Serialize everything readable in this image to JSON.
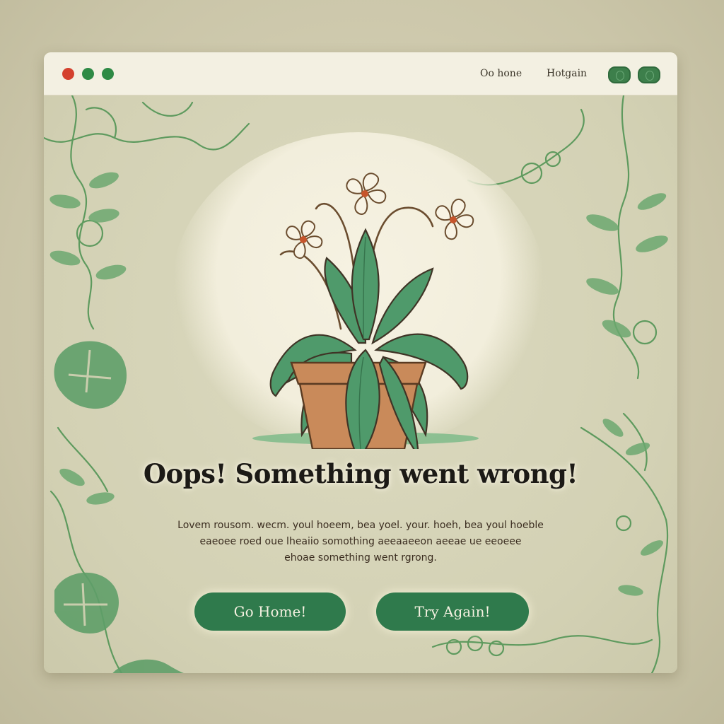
{
  "window": {
    "traffic_lights": [
      {
        "name": "close",
        "color": "#d4412e"
      },
      {
        "name": "minimize",
        "color": "#2e8a45"
      },
      {
        "name": "maximize",
        "color": "#2e8a45"
      }
    ],
    "nav": {
      "home_label": "Oo hone",
      "second_label": "Hotgain"
    },
    "toolbar_icons": [
      "toggle-icon",
      "toggle-icon"
    ]
  },
  "error": {
    "headline": "Oops! Something went wrong!",
    "body_lines": [
      "Lovem rousom. wecm. youl hoeem, bea yoel. your. hoeh, bea youl hoeble",
      "eaeoee roed oue lheaiio somothing aeeaaeeon aeeae ue eeoeee",
      "ehoae something went rgrong."
    ]
  },
  "actions": {
    "home_button": "Go Home!",
    "retry_button": "Try Again!"
  },
  "colors": {
    "accent": "#2f7a4c",
    "leaf": "#4c9a68",
    "pot": "#c98a5a",
    "background": "#d8d7bb"
  },
  "illustration": {
    "subject": "potted plant with flowers",
    "icon": "potted-plant-icon"
  }
}
